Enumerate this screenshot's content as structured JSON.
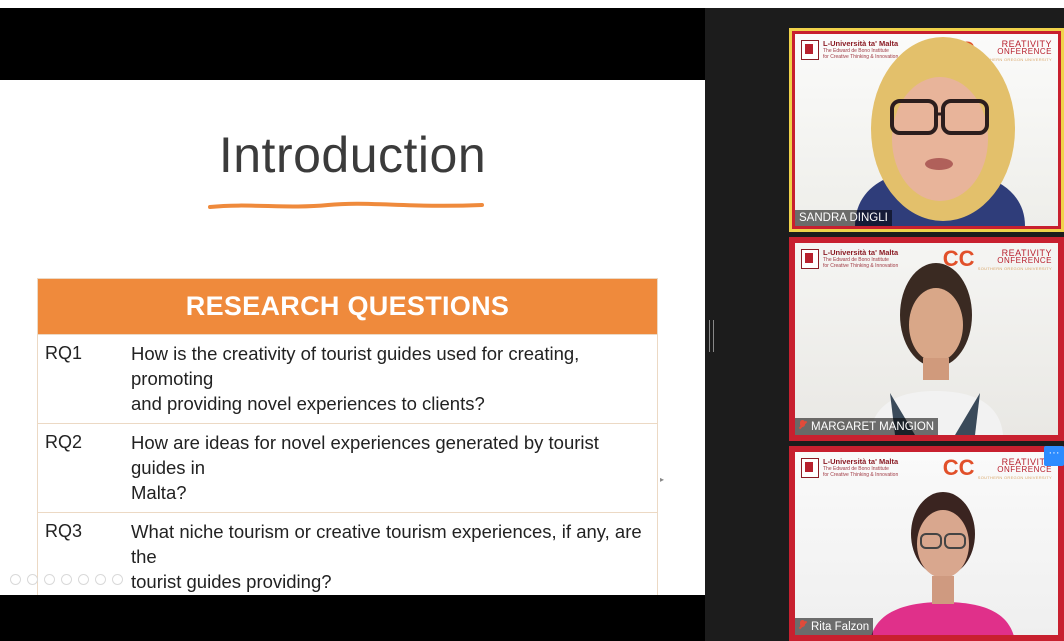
{
  "slide": {
    "title": "Introduction",
    "table": {
      "header": "RESEARCH QUESTIONS",
      "rows": [
        {
          "id": "RQ1",
          "line1": "How is the creativity of tourist guides used for creating, promoting",
          "line2": "and providing novel experiences to clients?"
        },
        {
          "id": "RQ2",
          "line1": "How are ideas for novel experiences generated by tourist guides in",
          "line2": "Malta?"
        },
        {
          "id": "RQ3",
          "line1": "What niche tourism or creative tourism experiences, if any, are the",
          "line2": "tourist guides providing?"
        }
      ]
    },
    "accent_color": "#ef8a3c"
  },
  "participants": [
    {
      "name": "SANDRA DINGLI",
      "active": true,
      "muted": false
    },
    {
      "name": "MARGARET MANGION",
      "active": false,
      "muted": true
    },
    {
      "name": "Rita Falzon",
      "active": false,
      "muted": true
    }
  ],
  "branding": {
    "university_line1": "L-Università ta' Malta",
    "university_line2": "The Edward de Bono Institute",
    "university_line3": "for Creative Thinking & Innovation",
    "conference_line1": "REATIVITY",
    "conference_line2": "ONFERENCE",
    "conference_line3": "SOUTHERN OREGON UNIVERSITY"
  },
  "more_button_label": "···",
  "colors": {
    "tile_border": "#c8202f",
    "active_speaker": "#f0d24a",
    "zoom_blue": "#2d8cff"
  }
}
